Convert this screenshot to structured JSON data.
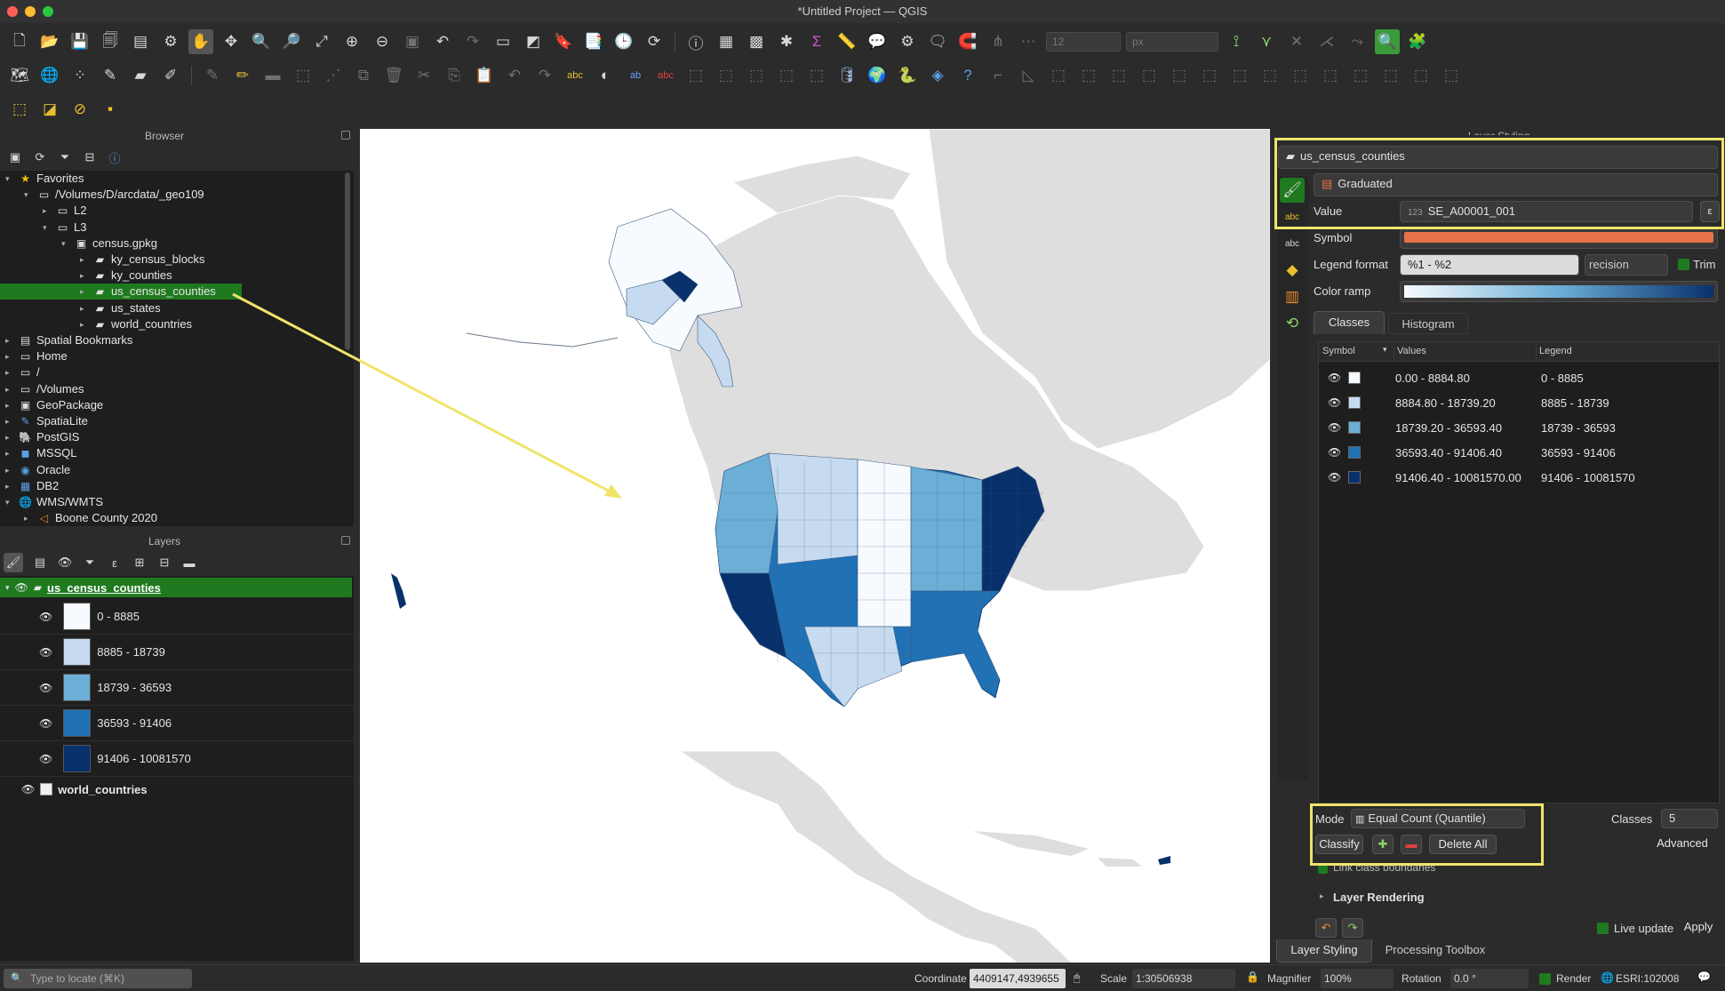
{
  "window": {
    "title": "*Untitled Project — QGIS"
  },
  "toolbar": {
    "font_size_value": "12",
    "unit_value": "px"
  },
  "browser": {
    "title": "Browser",
    "items": [
      {
        "label": "Favorites",
        "icon": "star-icon",
        "level": 0,
        "expanded": true
      },
      {
        "label": "/Volumes/D/arcdata/_geo109",
        "icon": "folder-icon",
        "level": 1,
        "expanded": true
      },
      {
        "label": "L2",
        "icon": "folder-icon",
        "level": 2,
        "expanded": false
      },
      {
        "label": "L3",
        "icon": "folder-icon",
        "level": 2,
        "expanded": true
      },
      {
        "label": "census.gpkg",
        "icon": "geopackage-icon",
        "level": 3,
        "expanded": true
      },
      {
        "label": "ky_census_blocks",
        "icon": "polygon-layer-icon",
        "level": 4
      },
      {
        "label": "ky_counties",
        "icon": "polygon-layer-icon",
        "level": 4
      },
      {
        "label": "us_census_counties",
        "icon": "polygon-layer-icon",
        "level": 4,
        "selected": true
      },
      {
        "label": "us_states",
        "icon": "polygon-layer-icon",
        "level": 4
      },
      {
        "label": "world_countries",
        "icon": "polygon-layer-icon",
        "level": 4
      },
      {
        "label": "Spatial Bookmarks",
        "icon": "bookmark-icon",
        "level": 0
      },
      {
        "label": "Home",
        "icon": "folder-icon",
        "level": 0
      },
      {
        "label": "/",
        "icon": "folder-icon",
        "level": 0
      },
      {
        "label": "/Volumes",
        "icon": "folder-icon",
        "level": 0
      },
      {
        "label": "GeoPackage",
        "icon": "geopackage-icon",
        "level": 0
      },
      {
        "label": "SpatiaLite",
        "icon": "spatialite-icon",
        "level": 0
      },
      {
        "label": "PostGIS",
        "icon": "postgis-icon",
        "level": 0
      },
      {
        "label": "MSSQL",
        "icon": "mssql-icon",
        "level": 0
      },
      {
        "label": "Oracle",
        "icon": "oracle-icon",
        "level": 0
      },
      {
        "label": "DB2",
        "icon": "db2-icon",
        "level": 0
      },
      {
        "label": "WMS/WMTS",
        "icon": "globe-icon",
        "level": 0,
        "expanded": true
      },
      {
        "label": "Boone County 2020",
        "icon": "wms-layer-icon",
        "level": 1
      }
    ]
  },
  "layers": {
    "title": "Layers",
    "items": [
      {
        "name": "us_census_counties",
        "visible": true,
        "selected": true
      },
      {
        "name": "world_countries",
        "visible": true,
        "selected": false
      }
    ],
    "legend": [
      {
        "label": "0 - 8885",
        "color": "#f7fbff"
      },
      {
        "label": "8885 - 18739",
        "color": "#c6dbef"
      },
      {
        "label": "18739 - 36593",
        "color": "#6baed6"
      },
      {
        "label": "36593 - 91406",
        "color": "#2171b5"
      },
      {
        "label": "91406 - 10081570",
        "color": "#08306b"
      }
    ]
  },
  "styling": {
    "title": "Layer Styling",
    "layer": "us_census_counties",
    "renderer": "Graduated",
    "value_label": "Value",
    "value": "SE_A00001_001",
    "symbol_label": "Symbol",
    "symbol_color": "#e8714a",
    "legend_format_label": "Legend format",
    "legend_format": "%1 - %2",
    "precision_label": "recision",
    "trim_label": "Trim",
    "color_ramp_label": "Color ramp",
    "tabs": [
      "Classes",
      "Histogram"
    ],
    "columns": [
      "Symbol",
      "Values",
      "Legend"
    ],
    "classes": [
      {
        "values": "0.00 - 8884.80",
        "legend": "0 - 8885",
        "color": "#f7fbff"
      },
      {
        "values": "8884.80 - 18739.20",
        "legend": "8885 - 18739",
        "color": "#c6dbef"
      },
      {
        "values": "18739.20 - 36593.40",
        "legend": "18739 - 36593",
        "color": "#6baed6"
      },
      {
        "values": "36593.40 - 91406.40",
        "legend": "36593 - 91406",
        "color": "#2171b5"
      },
      {
        "values": "91406.40 - 10081570.00",
        "legend": "91406 - 10081570",
        "color": "#08306b"
      }
    ],
    "mode_label": "Mode",
    "mode": "Equal Count (Quantile)",
    "classes_label": "Classes",
    "classes_count": "5",
    "classify": "Classify",
    "delete_all": "Delete All",
    "advanced": "Advanced",
    "link_boundaries": "Link class boundaries",
    "layer_rendering": "Layer Rendering",
    "live_update": "Live update",
    "apply": "Apply",
    "bottom_tabs": [
      "Layer Styling",
      "Processing Toolbox"
    ]
  },
  "status": {
    "locate_placeholder": "Type to locate (⌘K)",
    "coordinate_label": "Coordinate",
    "coordinate": "4409147,4939655",
    "scale_label": "Scale",
    "scale": "1:30506938",
    "magnifier_label": "Magnifier",
    "magnifier": "100%",
    "rotation_label": "Rotation",
    "rotation": "0.0 °",
    "render_label": "Render",
    "crs": "ESRI:102008"
  },
  "colors": {
    "highlight": "#f0e46a",
    "selection": "#1f7a1f",
    "accent": "#2f6fd6"
  }
}
